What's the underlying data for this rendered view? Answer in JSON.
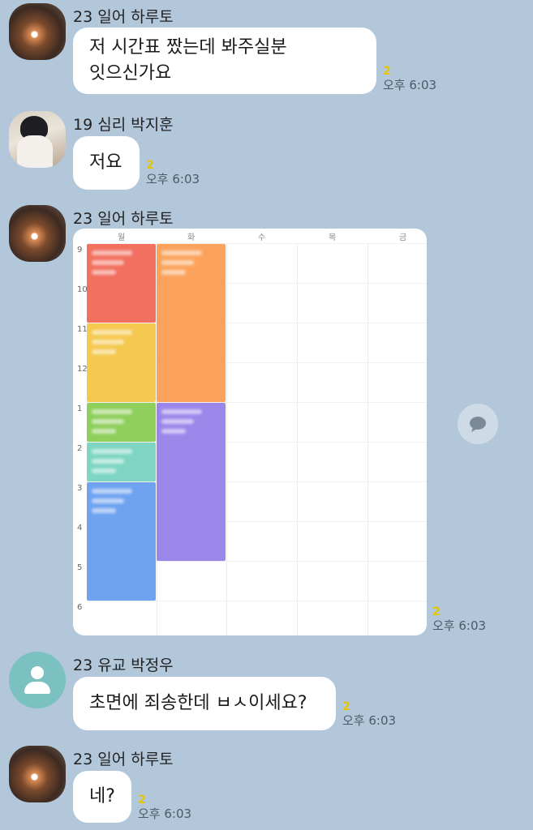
{
  "messages": [
    {
      "sender": "23 일어 하루토",
      "lines": [
        "저 시간표 짰는데 봐주실분",
        "잇으신가요"
      ],
      "unread": "2",
      "time": "오후 6:03"
    },
    {
      "sender": "19 심리 박지훈",
      "lines": [
        "저요"
      ],
      "unread": "2",
      "time": "오후 6:03"
    },
    {
      "sender": "23 일어 하루토",
      "unread": "2",
      "time": "오후 6:03"
    },
    {
      "sender": "23 유교 박정우",
      "lines": [
        "초면에 죄송한데 ㅂㅅ이세요?"
      ],
      "unread": "2",
      "time": "오후 6:03"
    },
    {
      "sender": "23 일어 하루토",
      "lines": [
        "네?"
      ],
      "unread": "2",
      "time": "오후 6:03"
    }
  ],
  "timetable": {
    "days": [
      "월",
      "화",
      "수",
      "목",
      "금"
    ],
    "hours": [
      "9",
      "10",
      "11",
      "12",
      "1",
      "2",
      "3",
      "4",
      "5",
      "6"
    ],
    "colors": {
      "red": "#f2705f",
      "yellow": "#f5c84f",
      "green": "#8fcf5c",
      "teal": "#7ed6c2",
      "blue": "#6fa3f0",
      "orange": "#fba35c",
      "purple": "#9b86ea"
    }
  },
  "icons": {
    "share": "speech-bubble-icon",
    "default_avatar": "person-icon"
  }
}
